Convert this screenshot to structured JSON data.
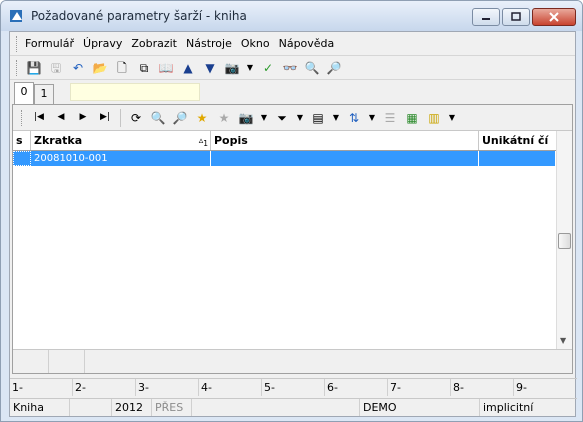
{
  "window": {
    "title": "Požadované parametry šarží - kniha",
    "buttons": [
      {
        "name": "minimize-icon"
      },
      {
        "name": "maximize-icon"
      },
      {
        "name": "close-icon"
      }
    ]
  },
  "menu": {
    "items": [
      "Formulář",
      "Úpravy",
      "Zobrazit",
      "Nástroje",
      "Okno",
      "Nápověda"
    ]
  },
  "toolbar": {
    "icons": [
      "save-icon",
      "save-as-icon",
      "undo-icon",
      "open-folder-icon",
      "new-document-icon",
      "copy-icon",
      "book-icon",
      "arrow-up-icon",
      "arrow-down-icon",
      "camera-icon",
      "dropdown-icon",
      "green-check-icon",
      "binoculars-icon",
      "binoculars-next-icon",
      "binoculars-prev-icon"
    ]
  },
  "tabs": [
    "0",
    "1"
  ],
  "nav": {
    "icons": [
      "first-record-icon",
      "prev-record-icon",
      "next-record-icon",
      "last-record-icon",
      "refresh-icon",
      "find-icon",
      "find-disabled-icon",
      "star-add-icon",
      "star-disabled-icon",
      "camera-icon",
      "filter-icon",
      "columns-icon",
      "sort-icon",
      "list-icon",
      "excel-icon",
      "notes-icon"
    ]
  },
  "grid": {
    "headers": {
      "s": "s",
      "zkratka": "Zkratka",
      "sort_indicator": "1",
      "popis": "Popis",
      "unikatni": "Unikátní čí"
    },
    "rows": [
      {
        "s": "",
        "zkratka": "20081010-001",
        "popis": "",
        "unikatni": ""
      }
    ]
  },
  "fkeys": [
    "1-",
    "2-",
    "3-",
    "4-",
    "5-",
    "6-",
    "7-",
    "8-",
    "9-"
  ],
  "status": {
    "module": "Kniha",
    "blank1": "",
    "year": "2012",
    "pres": "PŘES",
    "blank2": "",
    "demo": "DEMO",
    "mode": "implicitní"
  },
  "colors": {
    "selection": "#3399ff",
    "titlebar": "#c7d7ec"
  }
}
